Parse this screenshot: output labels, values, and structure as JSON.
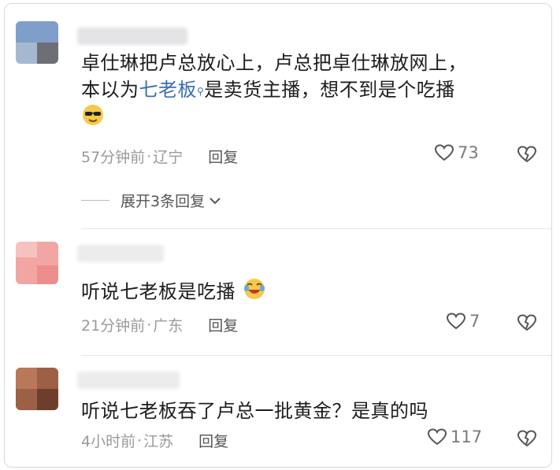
{
  "comments": [
    {
      "line1": "卓仕琳把卢总放心上，卢总把卓仕琳放网上，",
      "line2_pre": "本以为",
      "line2_mention": "七老板",
      "line2_post": "是卖货主播，想不到是个吃播",
      "emoji": "sunglasses-emoji",
      "time": "57分钟前",
      "location": "辽宁",
      "reply_label": "回复",
      "likes": "73"
    },
    {
      "text": "听说七老板是吃播",
      "emoji": "laughing-emoji",
      "time": "21分钟前",
      "location": "广东",
      "reply_label": "回复",
      "likes": "7"
    },
    {
      "text": "听说七老板吞了卢总一批黄金？是真的吗",
      "time": "4小时前",
      "location": "江苏",
      "reply_label": "回复",
      "likes": "117"
    }
  ],
  "expand_replies": "展开3条回复",
  "separator": "·"
}
